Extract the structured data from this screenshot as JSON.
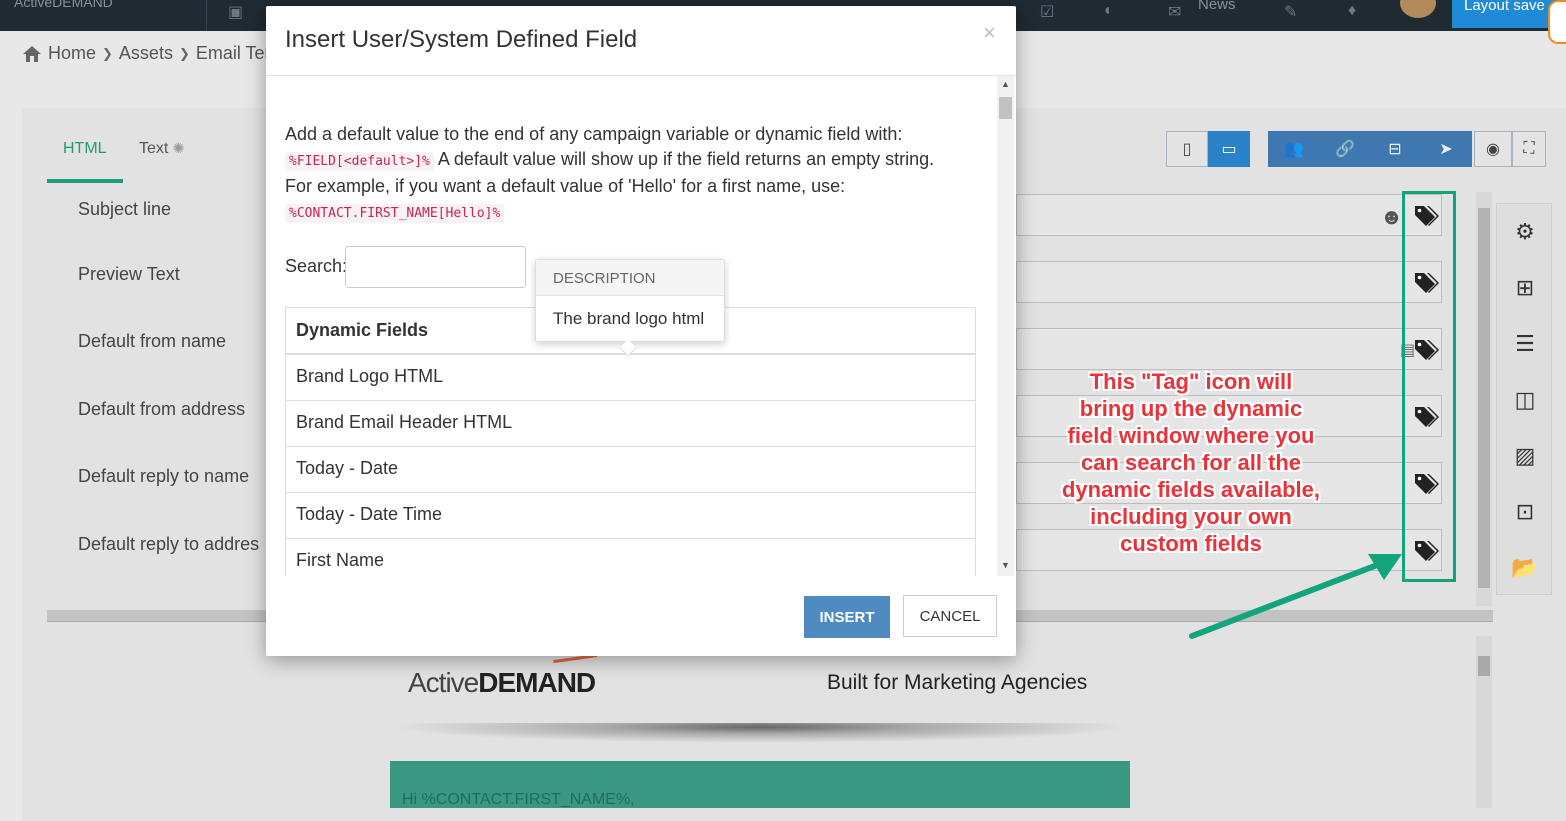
{
  "topnav": {
    "brand": "ActiveDEMAND",
    "news_label": "News",
    "layout_status": "Layout save"
  },
  "breadcrumb": {
    "items": [
      "Home",
      "Assets",
      "Email Ter"
    ]
  },
  "tabs": [
    {
      "label": "HTML",
      "active": true
    },
    {
      "label": "Text",
      "active": false
    }
  ],
  "fields": [
    {
      "label": "Subject line"
    },
    {
      "label": "Preview Text"
    },
    {
      "label": "Default from name"
    },
    {
      "label": "Default from address"
    },
    {
      "label": "Default reply to name"
    },
    {
      "label": "Default reply to addres"
    }
  ],
  "modal": {
    "title": "Insert User/System Defined Field",
    "close": "×",
    "help_line1": "Add a default value to the end of any campaign variable or dynamic field with:",
    "help_code1": "%FIELD[<default>]%",
    "help_line2": " A default value will show up if the field returns an empty string.",
    "help_line3": "For example, if you want a default value of 'Hello' for a first name, use:",
    "help_code2": "%CONTACT.FIRST_NAME[Hello]%",
    "search_label": "Search:",
    "search_value": "",
    "table_header": "Dynamic Fields",
    "rows": [
      "Brand Logo HTML",
      "Brand Email Header HTML",
      "Today - Date",
      "Today - Date Time",
      "First Name"
    ],
    "tooltip_header": "DESCRIPTION",
    "tooltip_body": "The brand logo html",
    "insert_label": "INSERT",
    "cancel_label": "CANCEL"
  },
  "preview": {
    "logo_light": "Active",
    "logo_bold": "DEMAND",
    "tagline": "Built for Marketing Agencies",
    "greeting": "Hi %CONTACT.FIRST_NAME%,"
  },
  "annotation": {
    "text": "This \"Tag\" icon will bring up the dynamic field window where you can search for all the dynamic fields available, including your own custom fields",
    "text_color": "#e8333a",
    "box_color": "#12a47c"
  },
  "colors": {
    "accent_green": "#1f9c7c",
    "primary_blue": "#4f8ac0",
    "nav_bg": "#202a33"
  }
}
